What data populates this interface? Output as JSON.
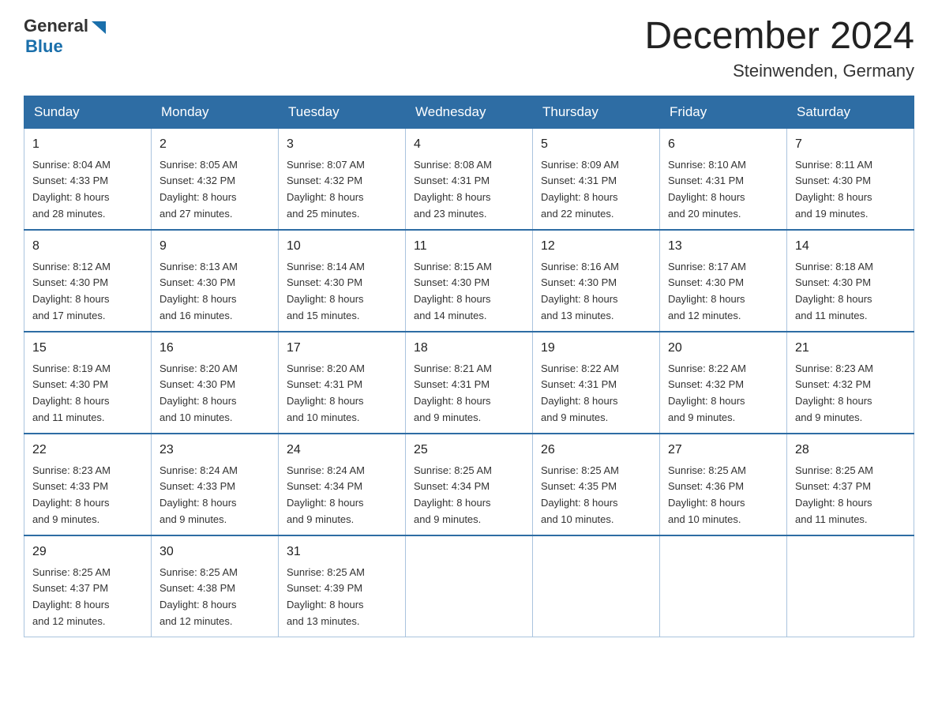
{
  "header": {
    "logo_general": "General",
    "logo_blue": "Blue",
    "month_title": "December 2024",
    "subtitle": "Steinwenden, Germany"
  },
  "weekdays": [
    "Sunday",
    "Monday",
    "Tuesday",
    "Wednesday",
    "Thursday",
    "Friday",
    "Saturday"
  ],
  "weeks": [
    [
      {
        "day": "1",
        "sunrise": "8:04 AM",
        "sunset": "4:33 PM",
        "daylight": "8 hours and 28 minutes."
      },
      {
        "day": "2",
        "sunrise": "8:05 AM",
        "sunset": "4:32 PM",
        "daylight": "8 hours and 27 minutes."
      },
      {
        "day": "3",
        "sunrise": "8:07 AM",
        "sunset": "4:32 PM",
        "daylight": "8 hours and 25 minutes."
      },
      {
        "day": "4",
        "sunrise": "8:08 AM",
        "sunset": "4:31 PM",
        "daylight": "8 hours and 23 minutes."
      },
      {
        "day": "5",
        "sunrise": "8:09 AM",
        "sunset": "4:31 PM",
        "daylight": "8 hours and 22 minutes."
      },
      {
        "day": "6",
        "sunrise": "8:10 AM",
        "sunset": "4:31 PM",
        "daylight": "8 hours and 20 minutes."
      },
      {
        "day": "7",
        "sunrise": "8:11 AM",
        "sunset": "4:30 PM",
        "daylight": "8 hours and 19 minutes."
      }
    ],
    [
      {
        "day": "8",
        "sunrise": "8:12 AM",
        "sunset": "4:30 PM",
        "daylight": "8 hours and 17 minutes."
      },
      {
        "day": "9",
        "sunrise": "8:13 AM",
        "sunset": "4:30 PM",
        "daylight": "8 hours and 16 minutes."
      },
      {
        "day": "10",
        "sunrise": "8:14 AM",
        "sunset": "4:30 PM",
        "daylight": "8 hours and 15 minutes."
      },
      {
        "day": "11",
        "sunrise": "8:15 AM",
        "sunset": "4:30 PM",
        "daylight": "8 hours and 14 minutes."
      },
      {
        "day": "12",
        "sunrise": "8:16 AM",
        "sunset": "4:30 PM",
        "daylight": "8 hours and 13 minutes."
      },
      {
        "day": "13",
        "sunrise": "8:17 AM",
        "sunset": "4:30 PM",
        "daylight": "8 hours and 12 minutes."
      },
      {
        "day": "14",
        "sunrise": "8:18 AM",
        "sunset": "4:30 PM",
        "daylight": "8 hours and 11 minutes."
      }
    ],
    [
      {
        "day": "15",
        "sunrise": "8:19 AM",
        "sunset": "4:30 PM",
        "daylight": "8 hours and 11 minutes."
      },
      {
        "day": "16",
        "sunrise": "8:20 AM",
        "sunset": "4:30 PM",
        "daylight": "8 hours and 10 minutes."
      },
      {
        "day": "17",
        "sunrise": "8:20 AM",
        "sunset": "4:31 PM",
        "daylight": "8 hours and 10 minutes."
      },
      {
        "day": "18",
        "sunrise": "8:21 AM",
        "sunset": "4:31 PM",
        "daylight": "8 hours and 9 minutes."
      },
      {
        "day": "19",
        "sunrise": "8:22 AM",
        "sunset": "4:31 PM",
        "daylight": "8 hours and 9 minutes."
      },
      {
        "day": "20",
        "sunrise": "8:22 AM",
        "sunset": "4:32 PM",
        "daylight": "8 hours and 9 minutes."
      },
      {
        "day": "21",
        "sunrise": "8:23 AM",
        "sunset": "4:32 PM",
        "daylight": "8 hours and 9 minutes."
      }
    ],
    [
      {
        "day": "22",
        "sunrise": "8:23 AM",
        "sunset": "4:33 PM",
        "daylight": "8 hours and 9 minutes."
      },
      {
        "day": "23",
        "sunrise": "8:24 AM",
        "sunset": "4:33 PM",
        "daylight": "8 hours and 9 minutes."
      },
      {
        "day": "24",
        "sunrise": "8:24 AM",
        "sunset": "4:34 PM",
        "daylight": "8 hours and 9 minutes."
      },
      {
        "day": "25",
        "sunrise": "8:25 AM",
        "sunset": "4:34 PM",
        "daylight": "8 hours and 9 minutes."
      },
      {
        "day": "26",
        "sunrise": "8:25 AM",
        "sunset": "4:35 PM",
        "daylight": "8 hours and 10 minutes."
      },
      {
        "day": "27",
        "sunrise": "8:25 AM",
        "sunset": "4:36 PM",
        "daylight": "8 hours and 10 minutes."
      },
      {
        "day": "28",
        "sunrise": "8:25 AM",
        "sunset": "4:37 PM",
        "daylight": "8 hours and 11 minutes."
      }
    ],
    [
      {
        "day": "29",
        "sunrise": "8:25 AM",
        "sunset": "4:37 PM",
        "daylight": "8 hours and 12 minutes."
      },
      {
        "day": "30",
        "sunrise": "8:25 AM",
        "sunset": "4:38 PM",
        "daylight": "8 hours and 12 minutes."
      },
      {
        "day": "31",
        "sunrise": "8:25 AM",
        "sunset": "4:39 PM",
        "daylight": "8 hours and 13 minutes."
      },
      null,
      null,
      null,
      null
    ]
  ],
  "labels": {
    "sunrise": "Sunrise:",
    "sunset": "Sunset:",
    "daylight": "Daylight:"
  }
}
